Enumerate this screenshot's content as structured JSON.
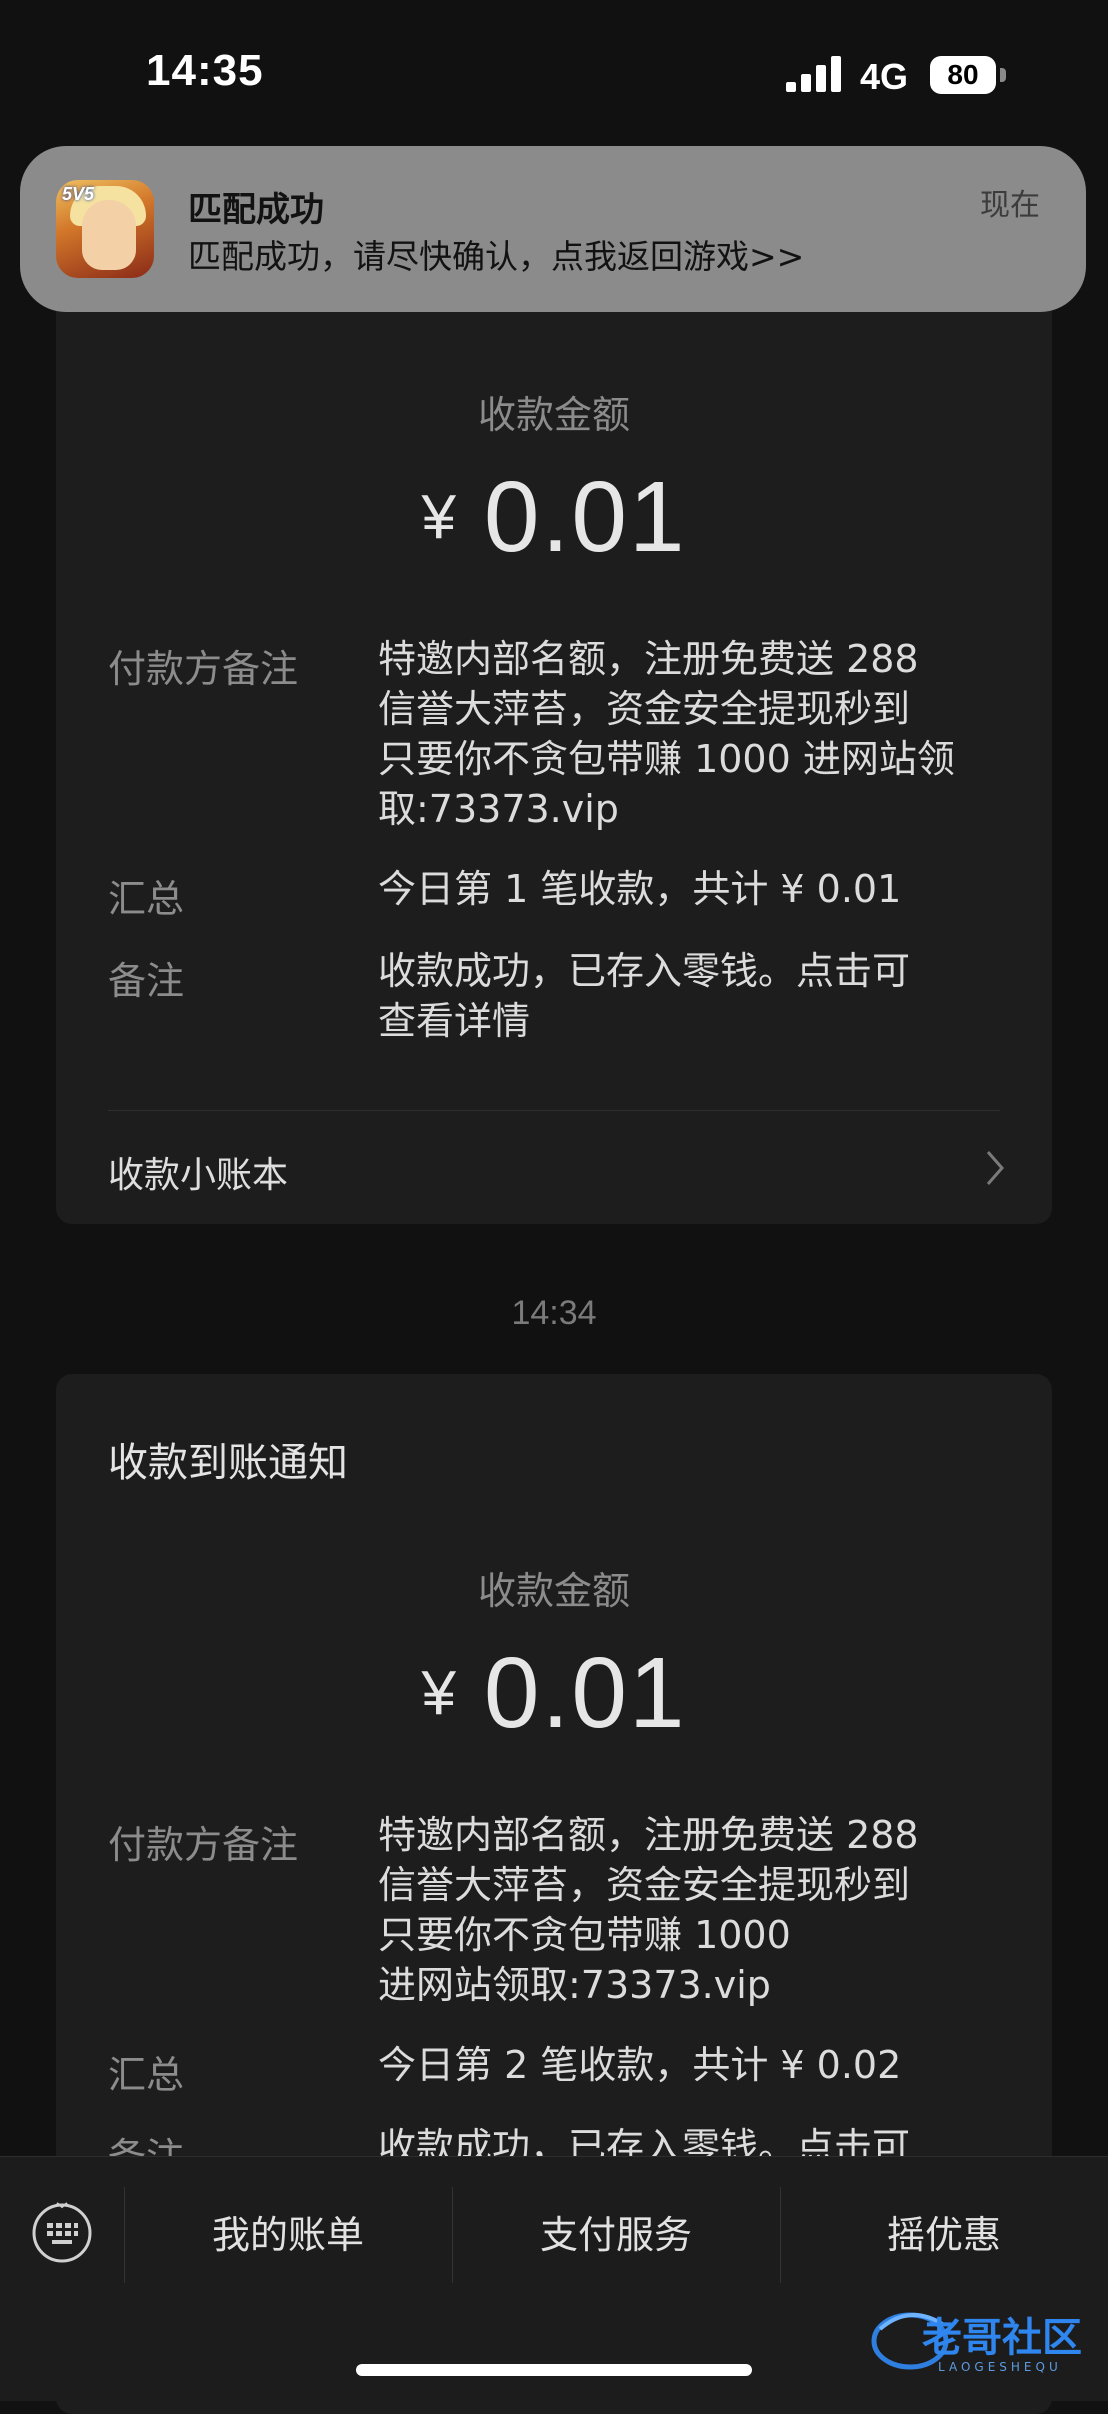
{
  "status_bar": {
    "time": "14:35",
    "network": "4G",
    "battery": "80"
  },
  "notification": {
    "app_icon": "honor-of-kings-app-icon",
    "title": "匹配成功",
    "body": "匹配成功，请尽快确认，点我返回游戏>>",
    "time": "现在"
  },
  "messages": [
    {
      "amount_label": "收款金额",
      "currency": "¥",
      "amount": "0.01",
      "payer_note_label": "付款方备注",
      "payer_note_lines": [
        "特邀内部名额，注册免费送 288",
        "信誉大萍苔，资金安全提现秒到",
        "只要你不贪包带赚 1000 进网站领",
        "取:73373.vip"
      ],
      "summary_label": "汇总",
      "summary": "今日第 1 笔收款，共计 ¥ 0.01",
      "remark_label": "备注",
      "remark_lines": [
        "收款成功，已存入零钱。点击可",
        "查看详情"
      ],
      "ledger_link": "收款小账本"
    },
    {
      "title": "收款到账通知",
      "amount_label": "收款金额",
      "currency": "¥",
      "amount": "0.01",
      "payer_note_label": "付款方备注",
      "payer_note_lines": [
        "特邀内部名额，注册免费送 288",
        "信誉大萍苔，资金安全提现秒到",
        "只要你不贪包带赚 1000",
        "进网站领取:73373.vip"
      ],
      "summary_label": "汇总",
      "summary": "今日第 2 笔收款，共计 ¥ 0.02",
      "remark_label": "备注",
      "remark_lines": [
        "收款成功，已存入零钱。点击可"
      ]
    }
  ],
  "time_separator": "14:34",
  "bottom_menu": {
    "keyboard_icon": "keyboard-icon",
    "items": [
      "我的账单",
      "支付服务",
      "摇优惠"
    ]
  },
  "watermark": {
    "text": "老哥社区",
    "subtext": "LAOGESHEQU"
  },
  "colors": {
    "background": "#111111",
    "card": "#1d1d1d",
    "banner": "#8b8b8b",
    "muted_text": "#8c8c8c",
    "primary_text": "#e4e4e4"
  }
}
